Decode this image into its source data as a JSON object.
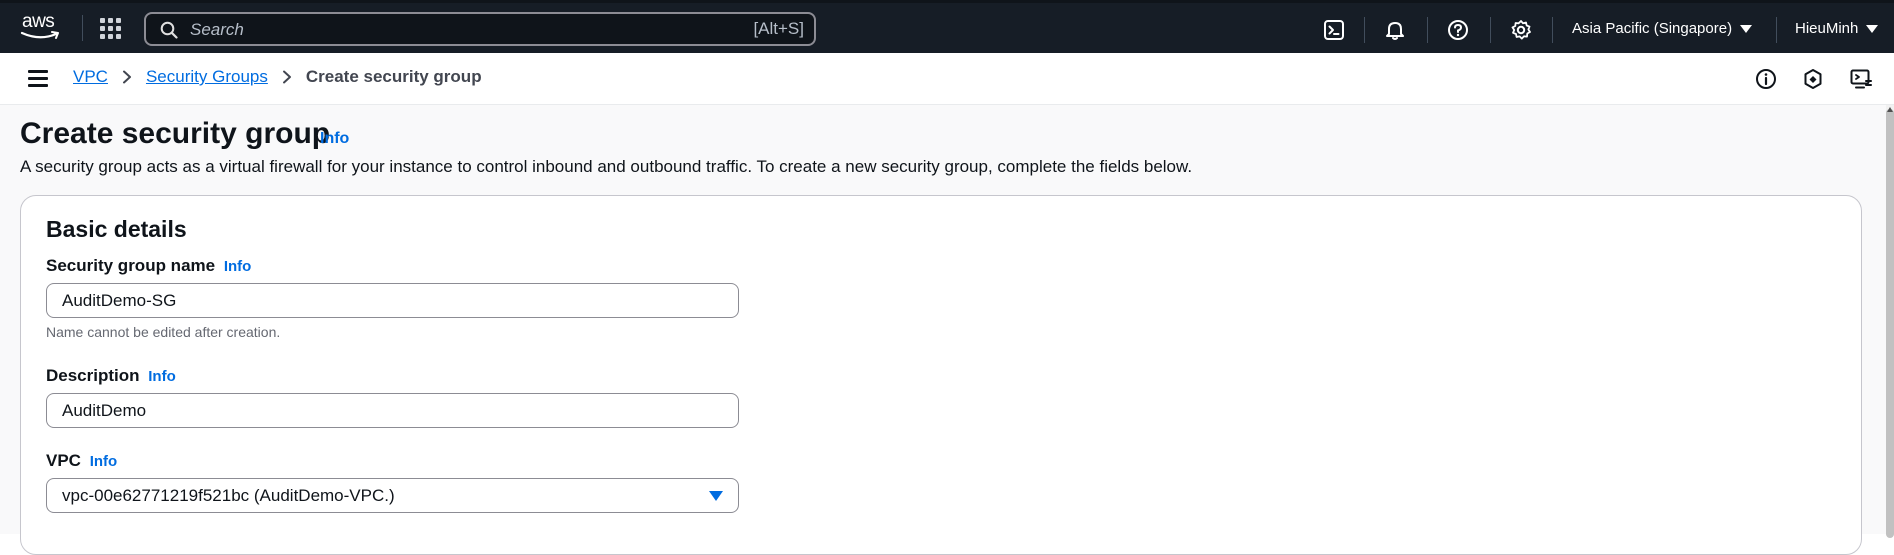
{
  "topnav": {
    "logo_text": "aws",
    "search": {
      "placeholder": "Search",
      "shortcut": "[Alt+S]"
    },
    "icons": [
      "cloudshell-icon",
      "bell-icon",
      "help-icon",
      "gear-icon"
    ],
    "region": "Asia Pacific (Singapore)",
    "user": "HieuMinh"
  },
  "breadcrumb": {
    "items": [
      {
        "label": "VPC"
      },
      {
        "label": "Security Groups"
      }
    ],
    "current": "Create security group"
  },
  "page": {
    "title": "Create security group",
    "info_label": "Info",
    "description": "A security group acts as a virtual firewall for your instance to control inbound and outbound traffic. To create a new security group, complete the fields below."
  },
  "basic_details": {
    "title": "Basic details",
    "name_field": {
      "label": "Security group name",
      "info": "Info",
      "value": "AuditDemo-SG",
      "hint": "Name cannot be edited after creation."
    },
    "description_field": {
      "label": "Description",
      "info": "Info",
      "value": "AuditDemo"
    },
    "vpc_field": {
      "label": "VPC",
      "info": "Info",
      "value": "vpc-00e62771219f521bc (AuditDemo-VPC.)"
    }
  },
  "colors": {
    "nav_bg": "#161d26",
    "link": "#006ce0",
    "page_bg": "#f9f9fa"
  }
}
